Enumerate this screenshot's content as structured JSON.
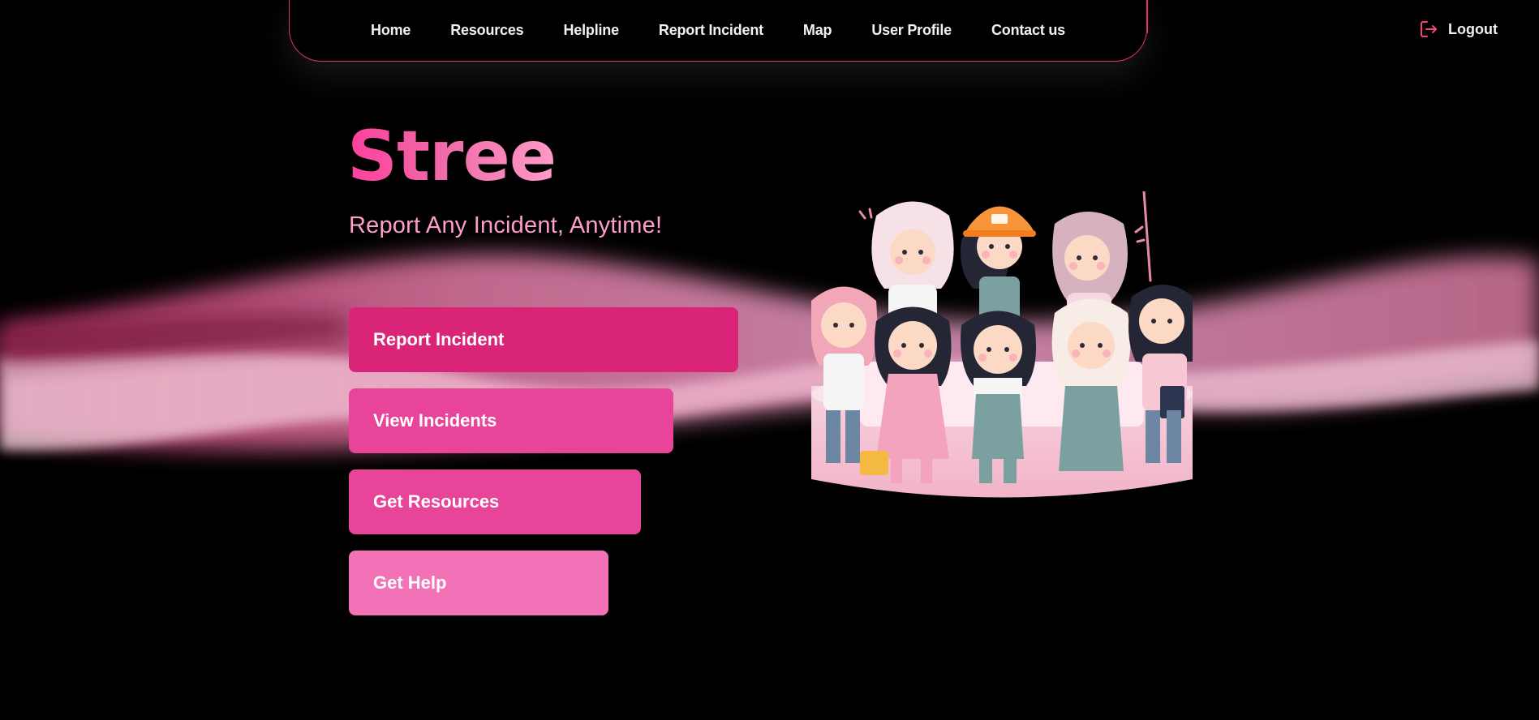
{
  "nav": {
    "items": [
      {
        "label": "Home"
      },
      {
        "label": "Resources"
      },
      {
        "label": "Helpline"
      },
      {
        "label": "Report Incident"
      },
      {
        "label": "Map"
      },
      {
        "label": "User Profile"
      },
      {
        "label": "Contact us"
      }
    ],
    "logout_label": "Logout",
    "logout_icon": "logout-icon"
  },
  "hero": {
    "title": "Stree",
    "subtitle": "Report Any Incident, Anytime!",
    "buttons": [
      {
        "label": "Report Incident"
      },
      {
        "label": "View Incidents"
      },
      {
        "label": "Get Resources"
      },
      {
        "label": "Get Help"
      }
    ],
    "illustration": "group-of-women-illustration"
  },
  "colors": {
    "background": "#000000",
    "accent": "#e0307a",
    "button_primary": "#d92478",
    "button_secondary": "#e8449a",
    "button_light": "#f271b7",
    "subtitle": "#ff9fc9"
  }
}
